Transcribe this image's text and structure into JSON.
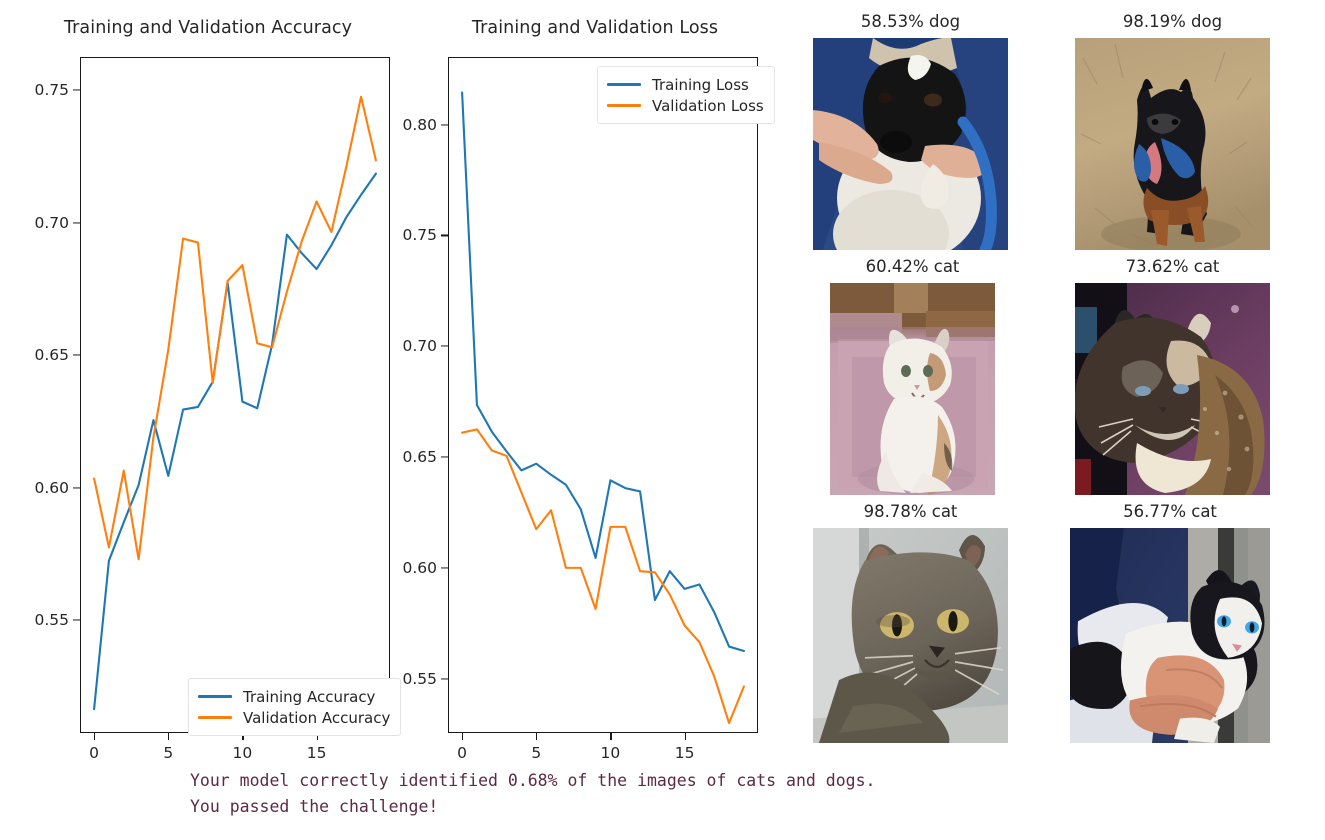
{
  "chart_data": [
    {
      "type": "line",
      "title": "Training and Validation Accuracy",
      "xlabel": "",
      "ylabel": "",
      "xlim": [
        -0.95,
        19.95
      ],
      "ylim": [
        0.5075,
        0.7625
      ],
      "xticks": [
        0,
        5,
        10,
        15
      ],
      "yticks": [
        0.55,
        0.6,
        0.65,
        0.7,
        0.75
      ],
      "ytick_labels": [
        "0.55",
        "0.60",
        "0.65",
        "0.70",
        "0.75"
      ],
      "xtick_labels": [
        "0",
        "5",
        "10",
        "15"
      ],
      "grid": false,
      "legend_position": "lower right",
      "x": [
        0,
        1,
        2,
        3,
        4,
        5,
        6,
        7,
        8,
        9,
        10,
        11,
        12,
        13,
        14,
        15,
        16,
        17,
        18,
        19
      ],
      "series": [
        {
          "name": "Training Accuracy",
          "color": "#1f77b4",
          "values": [
            0.5165,
            0.5725,
            0.587,
            0.601,
            0.6255,
            0.6045,
            0.6295,
            0.6305,
            0.64,
            0.6775,
            0.6325,
            0.63,
            0.654,
            0.6955,
            0.6885,
            0.6825,
            0.6915,
            0.702,
            0.7105,
            0.7185
          ]
        },
        {
          "name": "Validation Accuracy",
          "color": "#ff7f0e",
          "values": [
            0.6035,
            0.5775,
            0.6065,
            0.573,
            0.619,
            0.652,
            0.694,
            0.6925,
            0.6395,
            0.678,
            0.684,
            0.6545,
            0.653,
            0.674,
            0.693,
            0.708,
            0.6965,
            0.721,
            0.7475,
            0.7235
          ]
        }
      ]
    },
    {
      "type": "line",
      "title": "Training and Validation Loss",
      "xlabel": "",
      "ylabel": "",
      "xlim": [
        -0.95,
        19.95
      ],
      "ylim": [
        0.5255,
        0.8305
      ],
      "xticks": [
        0,
        5,
        10,
        15
      ],
      "yticks": [
        0.55,
        0.6,
        0.65,
        0.7,
        0.75,
        0.8
      ],
      "ytick_labels": [
        "0.55",
        "0.60",
        "0.65",
        "0.70",
        "0.75",
        "0.80"
      ],
      "xtick_labels": [
        "0",
        "5",
        "10",
        "15"
      ],
      "grid": false,
      "legend_position": "upper right",
      "x": [
        0,
        1,
        2,
        3,
        4,
        5,
        6,
        7,
        8,
        9,
        10,
        11,
        12,
        13,
        14,
        15,
        16,
        17,
        18,
        19
      ],
      "series": [
        {
          "name": "Training Loss",
          "color": "#1f77b4",
          "values": [
            0.8145,
            0.6735,
            0.6615,
            0.6525,
            0.644,
            0.647,
            0.642,
            0.6375,
            0.6265,
            0.6045,
            0.6395,
            0.636,
            0.6345,
            0.5855,
            0.5985,
            0.5905,
            0.5925,
            0.58,
            0.5645,
            0.5625
          ]
        },
        {
          "name": "Validation Loss",
          "color": "#ff7f0e",
          "values": [
            0.661,
            0.6625,
            0.653,
            0.6505,
            0.634,
            0.6175,
            0.626,
            0.6,
            0.6,
            0.5815,
            0.6185,
            0.6185,
            0.5985,
            0.598,
            0.588,
            0.574,
            0.5665,
            0.551,
            0.53,
            0.5465
          ]
        }
      ]
    }
  ],
  "charts": {
    "accuracy": {
      "title": "Training and Validation Accuracy",
      "legend": [
        {
          "label": "Training Accuracy",
          "color": "#1f77b4"
        },
        {
          "label": "Validation Accuracy",
          "color": "#ff7f0e"
        }
      ]
    },
    "loss": {
      "title": "Training and Validation Loss",
      "legend": [
        {
          "label": "Training Loss",
          "color": "#1f77b4"
        },
        {
          "label": "Validation Loss",
          "color": "#ff7f0e"
        }
      ]
    }
  },
  "predictions": [
    {
      "caption": "58.53% dog",
      "confidence": "58.53%",
      "label": "dog",
      "alt": "black-and-white dog held by person in blue jacket with blue leash"
    },
    {
      "caption": "98.19% dog",
      "confidence": "98.19%",
      "label": "dog",
      "alt": "black and tan dog sitting on dry grass with blue collar"
    },
    {
      "caption": "60.42% cat",
      "confidence": "60.42%",
      "label": "cat",
      "alt": "white and calico cat sitting on pink rug"
    },
    {
      "caption": "73.62% cat",
      "confidence": "73.62%",
      "label": "cat",
      "alt": "tortoiseshell cat resting against purple wall"
    },
    {
      "caption": "98.78% cat",
      "confidence": "98.78%",
      "label": "cat",
      "alt": "grey cat close-up facing camera"
    },
    {
      "caption": "56.77% cat",
      "confidence": "56.77%",
      "label": "cat",
      "alt": "black and white cat being held in hands"
    }
  ],
  "footer": {
    "line1": "Your model correctly identified 0.68% of the images of cats and dogs.",
    "line2": "You passed the challenge!",
    "color": "#5b2a43"
  }
}
